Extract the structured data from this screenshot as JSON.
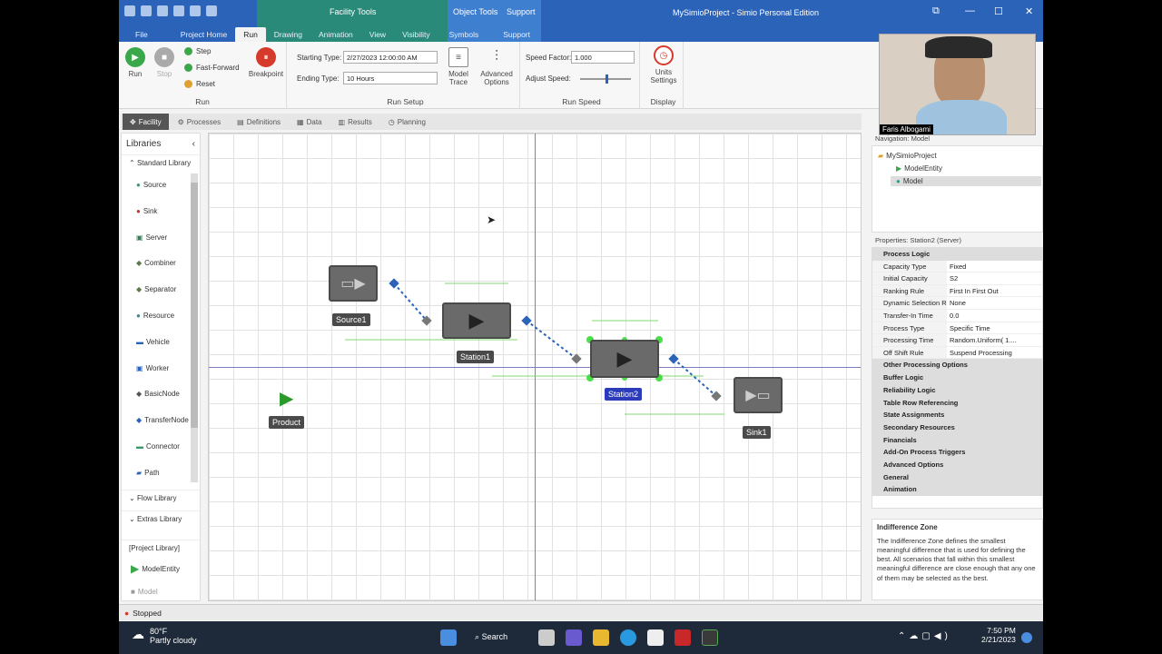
{
  "window": {
    "title": "MySimioProject - Simio Personal Edition",
    "tools_tab": "Facility Tools",
    "object_tools": "Object Tools",
    "support": "Support"
  },
  "tabs": [
    "File",
    "Project Home",
    "Run",
    "Drawing",
    "Animation",
    "View",
    "Visibility",
    "Symbols",
    "Support"
  ],
  "ribbon": {
    "run_group": "Run",
    "run": "Run",
    "stop": "Stop",
    "step": "Step",
    "fast_forward": "Fast-Forward",
    "reset": "Reset",
    "breakpoint": "Breakpoint",
    "run_setup_group": "Run Setup",
    "starting_type_label": "Starting Type:",
    "starting_type_value": "2/27/2023 12:00:00 AM",
    "ending_type_label": "Ending Type:",
    "ending_type_value": "10 Hours",
    "model_trace": "Model Trace",
    "advanced_options": "Advanced Options",
    "run_speed_group": "Run Speed",
    "speed_factor_label": "Speed Factor:",
    "speed_factor_value": "1.000",
    "adjust_speed_label": "Adjust Speed:",
    "display_group": "Display",
    "units_settings": "Units Settings"
  },
  "view_tabs": [
    "Facility",
    "Processes",
    "Definitions",
    "Data",
    "Results",
    "Planning"
  ],
  "libraries": {
    "title": "Libraries",
    "standard": "Standard Library",
    "items": [
      "Source",
      "Sink",
      "Server",
      "Combiner",
      "Separator",
      "Resource",
      "Vehicle",
      "Worker",
      "BasicNode",
      "TransferNode",
      "Connector",
      "Path"
    ],
    "flow": "Flow Library",
    "extras": "Extras Library",
    "project": "[Project Library]",
    "project_items": [
      "ModelEntity",
      "Model"
    ]
  },
  "canvas": {
    "objects": [
      "Source1",
      "Station1",
      "Station2",
      "Sink1",
      "Product"
    ]
  },
  "navigation": {
    "title": "Navigation: Model",
    "items": [
      "MySimioProject",
      "ModelEntity",
      "Model"
    ]
  },
  "properties": {
    "title": "Properties: Station2 (Server)",
    "rows": [
      {
        "c": "Process Logic"
      },
      {
        "k": "Capacity Type",
        "v": "Fixed"
      },
      {
        "k": "Initial Capacity",
        "v": "S2"
      },
      {
        "k": "Ranking Rule",
        "v": "First In First Out"
      },
      {
        "k": "Dynamic Selection Rule",
        "v": "None"
      },
      {
        "k": "Transfer-In Time",
        "v": "0.0"
      },
      {
        "k": "Process Type",
        "v": "Specific Time"
      },
      {
        "k": "Processing Time",
        "v": "Random.Uniform( 1...."
      },
      {
        "k": "Off Shift Rule",
        "v": "Suspend Processing"
      },
      {
        "c": "Other Processing Options"
      },
      {
        "c": "Buffer Logic"
      },
      {
        "c": "Reliability Logic"
      },
      {
        "c": "Table Row Referencing"
      },
      {
        "c": "State Assignments"
      },
      {
        "c": "Secondary Resources"
      },
      {
        "c": "Financials"
      },
      {
        "c": "Add-On Process Triggers"
      },
      {
        "c": "Advanced Options"
      },
      {
        "c": "General"
      },
      {
        "c": "Animation"
      }
    ]
  },
  "description": {
    "title": "Indifference Zone",
    "text": "The Indifference Zone defines the smallest meaningful difference that is used for defining the best. All scenarios that fall within this smallest meaningful difference are close enough that any one of them may be selected as the best."
  },
  "status": {
    "text": "Stopped"
  },
  "taskbar": {
    "temp": "80°F",
    "weather": "Partly cloudy",
    "search": "Search",
    "time": "7:50 PM",
    "date": "2/21/2023"
  },
  "webcam": {
    "name": "Faris Albogami"
  }
}
